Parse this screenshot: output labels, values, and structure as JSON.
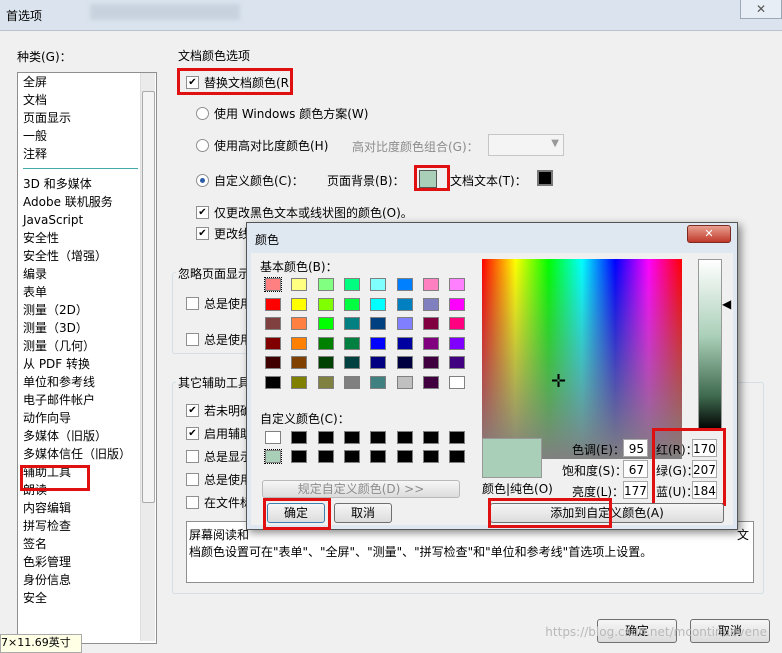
{
  "window": {
    "title": "首选项",
    "close": "✕"
  },
  "category": {
    "label": "种类(G)：",
    "items_top": [
      "全屏",
      "文档",
      "页面显示",
      "一般",
      "注释"
    ],
    "items_bottom": [
      "3D 和多媒体",
      "Adobe 联机服务",
      "JavaScript",
      "安全性",
      "安全性（增强）",
      "编录",
      "表单",
      "测量（2D）",
      "测量（3D）",
      "测量（几何）",
      "从 PDF 转换",
      "单位和参考线",
      "电子邮件帐户",
      "动作向导",
      "多媒体（旧版）",
      "多媒体信任（旧版）",
      "辅助工具",
      "朗读",
      "内容编辑",
      "拼写检查",
      "签名",
      "色彩管理",
      "身份信息",
      "安全"
    ]
  },
  "doc_color": {
    "group_title": "文档颜色选项",
    "replace": "替换文档颜色(R)",
    "use_windows": "使用 Windows 颜色方案(W)",
    "use_high_contrast": "使用高对比度颜色(H)",
    "high_contrast_combo": "高对比度颜色组合(G)：",
    "custom": "自定义颜色(C)：",
    "page_bg": "页面背景(B)：",
    "doc_text": "文档文本(T)：",
    "only_black": "仅更改黑色文本或线状图的颜色(O)。",
    "change_line": "更改线"
  },
  "ignore": {
    "title": "忽略页面显示",
    "opt1": "总是使用",
    "opt2": "总是使用"
  },
  "other": {
    "title": "其它辅助工具",
    "opt1": "若未明确",
    "opt2": "启用辅助",
    "opt3": "总是显示",
    "opt4": "总是使用",
    "opt5": "在文件标",
    "desc_line1": "屏幕阅读和",
    "desc_tail": "文",
    "desc_line2": "档颜色设置可在\"表单\"、\"全屏\"、\"测量\"、\"拼写检查\"和\"单位和参考线\"首选项上设置。"
  },
  "color_dialog": {
    "title": "颜色",
    "basic_label": "基本颜色(B)：",
    "custom_label": "自定义颜色(C)：",
    "define_custom": "规定自定义颜色(D) >>",
    "ok": "确定",
    "cancel": "取消",
    "add_custom": "添加到自定义颜色(A)",
    "solid_label": "颜色|纯色(O)",
    "hue_label": "色调(E)：",
    "hue": "95",
    "sat_label": "饱和度(S)：",
    "sat": "67",
    "lum_label": "亮度(L)：",
    "lum": "177",
    "red_label": "红(R)：",
    "red": "170",
    "green_label": "绿(G)：",
    "green": "207",
    "blue_label": "蓝(U)：",
    "blue": "184",
    "current_color": "#aacfb8",
    "basic_colors": [
      "#ff8080",
      "#ffff80",
      "#80ff80",
      "#00ff80",
      "#80ffff",
      "#0080ff",
      "#ff80c0",
      "#ff80ff",
      "#ff0000",
      "#ffff00",
      "#80ff00",
      "#00ff40",
      "#00ffff",
      "#0080c0",
      "#8080c0",
      "#ff00ff",
      "#804040",
      "#ff8040",
      "#00ff00",
      "#008080",
      "#004080",
      "#8080ff",
      "#800040",
      "#ff0080",
      "#800000",
      "#ff8000",
      "#008000",
      "#008040",
      "#0000ff",
      "#0000a0",
      "#800080",
      "#8000ff",
      "#400000",
      "#804000",
      "#004000",
      "#004040",
      "#000080",
      "#000040",
      "#400040",
      "#400080",
      "#000000",
      "#808000",
      "#808040",
      "#808080",
      "#408080",
      "#c0c0c0",
      "#400040",
      "#ffffff"
    ],
    "custom_colors": [
      "#ffffff",
      "#000000",
      "#000000",
      "#000000",
      "#000000",
      "#000000",
      "#000000",
      "#000000",
      "#aacfb8",
      "#000000",
      "#000000",
      "#000000",
      "#000000",
      "#000000",
      "#000000",
      "#000000"
    ]
  },
  "footer": {
    "ok": "确定",
    "cancel": "取消",
    "watermark": "https://blog.csdn.net/mcontinuevene",
    "status": "7×11.69英寸"
  }
}
